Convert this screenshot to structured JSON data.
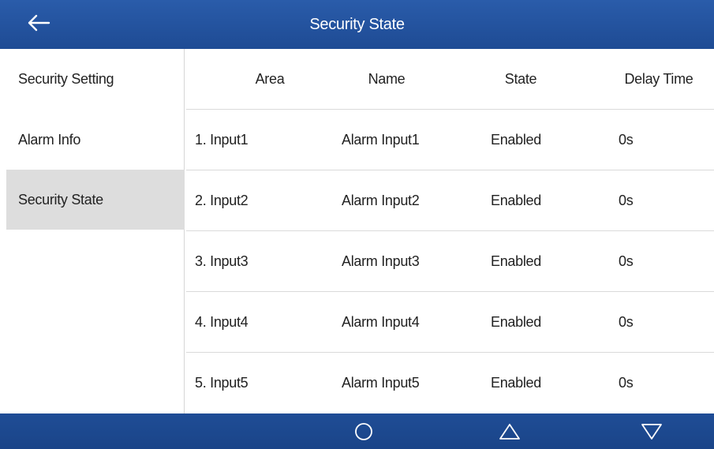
{
  "header": {
    "title": "Security State"
  },
  "sidebar": {
    "items": [
      {
        "label": "Security Setting",
        "active": false
      },
      {
        "label": "Alarm Info",
        "active": false
      },
      {
        "label": "Security State",
        "active": true
      }
    ]
  },
  "table": {
    "columns": [
      "Area",
      "Name",
      "State",
      "Delay Time"
    ],
    "rows": [
      {
        "area": "1. Input1",
        "name": "Alarm Input1",
        "state": "Enabled",
        "delay": "0s"
      },
      {
        "area": "2. Input2",
        "name": "Alarm Input2",
        "state": "Enabled",
        "delay": "0s"
      },
      {
        "area": "3. Input3",
        "name": "Alarm Input3",
        "state": "Enabled",
        "delay": "0s"
      },
      {
        "area": "4. Input4",
        "name": "Alarm Input4",
        "state": "Enabled",
        "delay": "0s"
      },
      {
        "area": "5. Input5",
        "name": "Alarm Input5",
        "state": "Enabled",
        "delay": "0s"
      }
    ]
  },
  "navbar": {
    "icons": [
      "home-circle-icon",
      "up-triangle-icon",
      "down-triangle-icon"
    ]
  },
  "colors": {
    "header_bg": "#2a5caa",
    "navbar_bg": "#1f4d96",
    "active_item_bg": "#dddddd",
    "divider": "#dadada"
  }
}
